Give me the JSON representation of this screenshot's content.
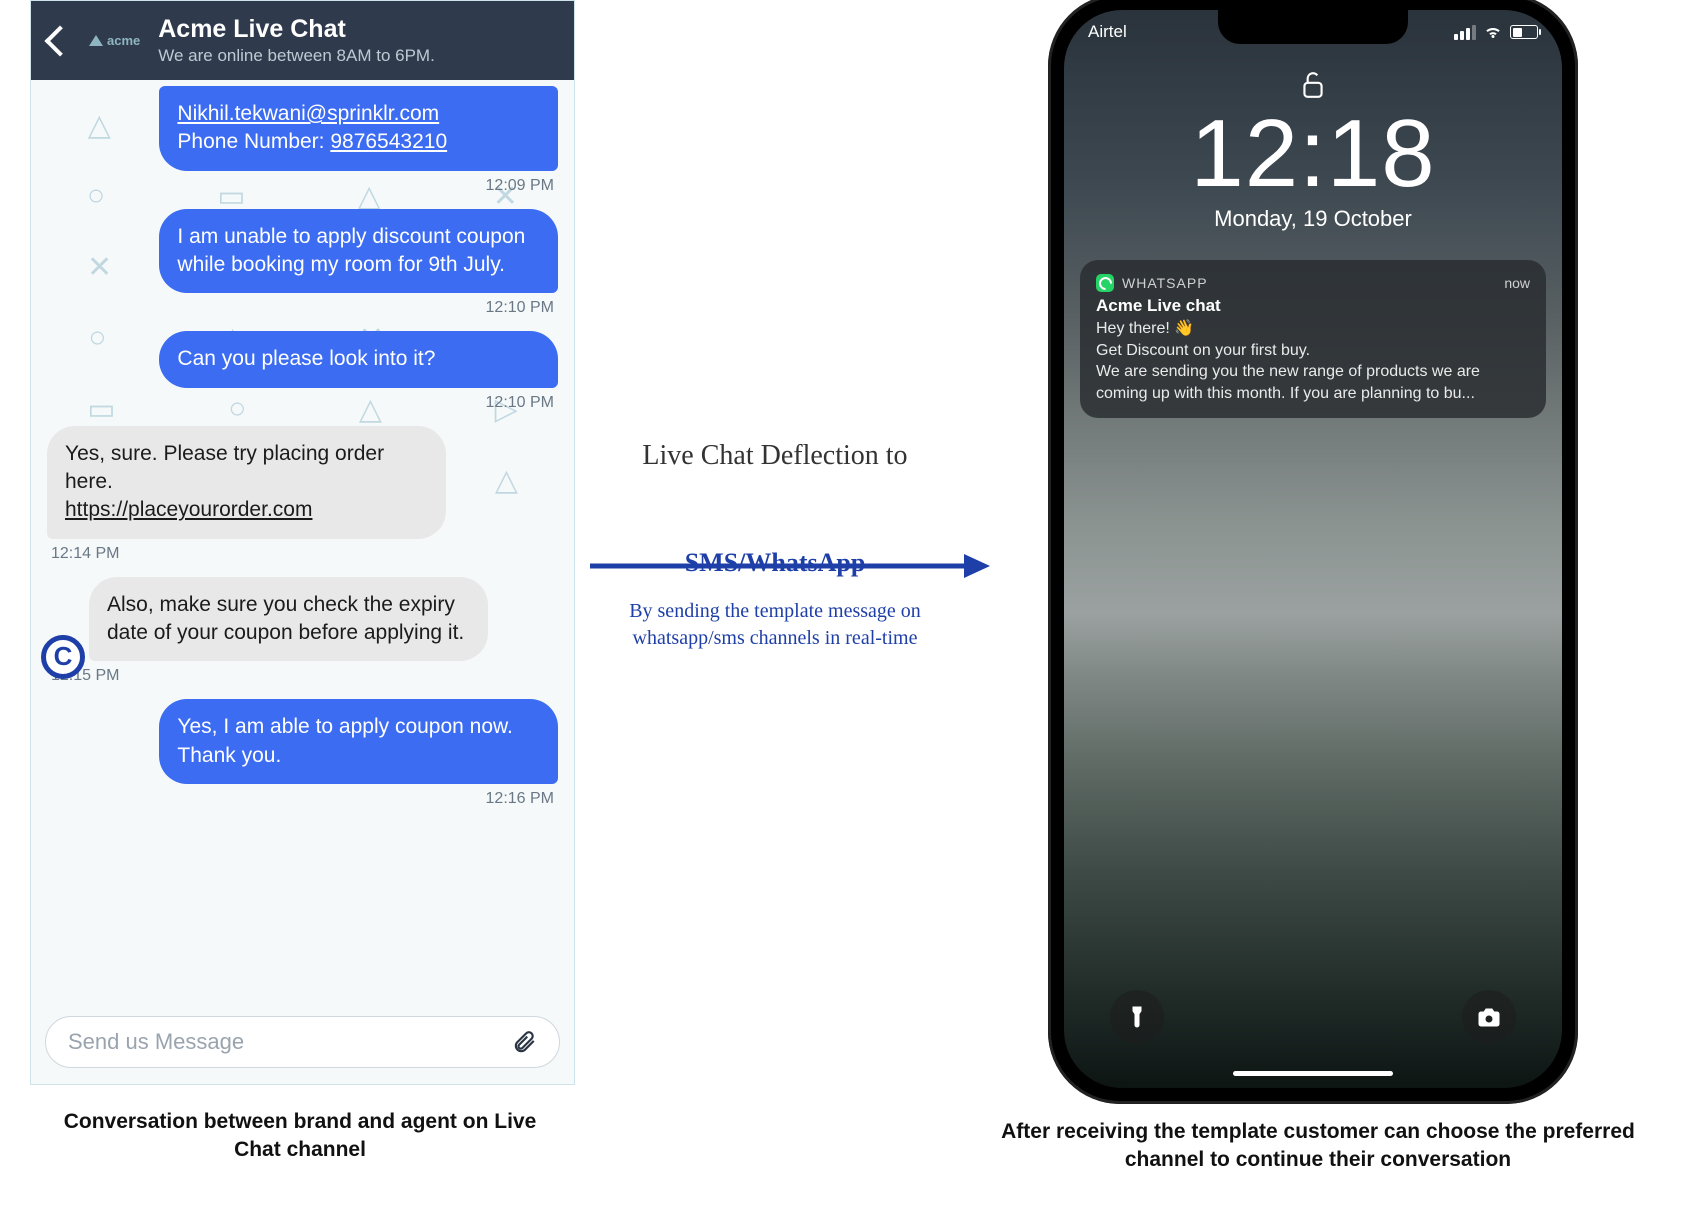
{
  "chat": {
    "header_title": "Acme Live Chat",
    "header_subtitle": "We are online between 8AM to 6PM.",
    "brand_text": "acme",
    "input_placeholder": "Send us Message",
    "messages": {
      "m0_email": "Nikhil.tekwani@sprinklr.com",
      "m0_phone_label": "Phone Number: ",
      "m0_phone": "9876543210",
      "t0": "12:09 PM",
      "m1": "I am unable to apply discount coupon while booking my room for 9th July.",
      "t1": "12:10 PM",
      "m2": "Can you please look into it?",
      "t2": "12:10 PM",
      "m3a": "Yes, sure. Please try placing order here.",
      "m3_link": "https://placeyourorder.com",
      "t3": "12:14 PM",
      "m4": "Also, make sure you check the expiry date of your coupon before applying it.",
      "t4": "12:15 PM",
      "m5": "Yes, I am able to apply coupon now.\nThank you.",
      "t5": "12:16 PM"
    }
  },
  "middle": {
    "line1": "Live Chat Deflection to",
    "line2": "SMS/WhatsApp",
    "line3": "By sending the template message on whatsapp/sms channels in real-time"
  },
  "phone": {
    "carrier": "Airtel",
    "time": "12:18",
    "date": "Monday, 19 October",
    "notif_app": "WHATSAPP",
    "notif_when": "now",
    "notif_sender": "Acme Live chat",
    "notif_body": "Hey there! 👋\nGet Discount on your first buy.\nWe are sending you the new range of products we are coming up with this month. If you are planning to bu..."
  },
  "captions": {
    "left": "Conversation between brand and agent on Live Chat channel",
    "right": "After receiving the template customer can choose the preferred channel to continue their conversation"
  }
}
